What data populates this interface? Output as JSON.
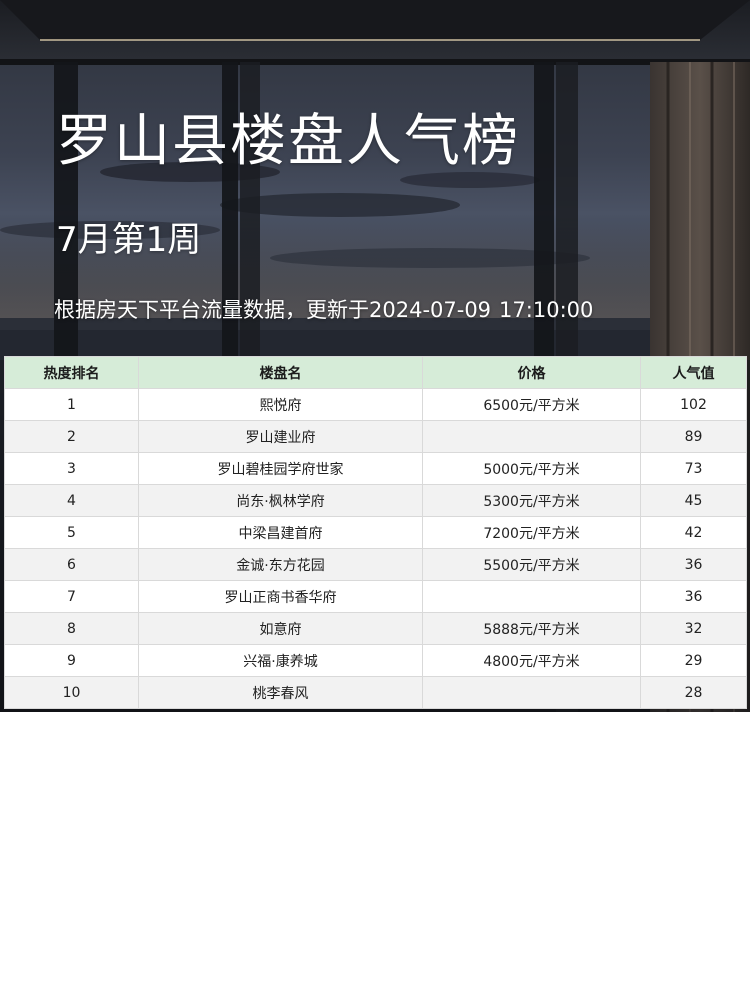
{
  "page": {
    "title": "罗山县楼盘人气榜",
    "subtitle": "7月第1周",
    "update_prefix": "根据房天下平台流量数据，更新于",
    "update_date": "2024-07-09",
    "update_time": "17:10:00"
  },
  "table": {
    "headers": [
      "热度排名",
      "楼盘名",
      "价格",
      "人气值"
    ],
    "rows": [
      {
        "rank": "1",
        "name": "熙悦府",
        "price": "6500元/平方米",
        "popularity": "102"
      },
      {
        "rank": "2",
        "name": "罗山建业府",
        "price": "",
        "popularity": "89"
      },
      {
        "rank": "3",
        "name": "罗山碧桂园学府世家",
        "price": "5000元/平方米",
        "popularity": "73"
      },
      {
        "rank": "4",
        "name": "尚东·枫林学府",
        "price": "5300元/平方米",
        "popularity": "45"
      },
      {
        "rank": "5",
        "name": "中梁昌建首府",
        "price": "7200元/平方米",
        "popularity": "42"
      },
      {
        "rank": "6",
        "name": "金诚·东方花园",
        "price": "5500元/平方米",
        "popularity": "36"
      },
      {
        "rank": "7",
        "name": "罗山正商书香华府",
        "price": "",
        "popularity": "36"
      },
      {
        "rank": "8",
        "name": "如意府",
        "price": "5888元/平方米",
        "popularity": "32"
      },
      {
        "rank": "9",
        "name": "兴福·康养城",
        "price": "4800元/平方米",
        "popularity": "29"
      },
      {
        "rank": "10",
        "name": "桃李春风",
        "price": "",
        "popularity": "28"
      }
    ]
  },
  "colors": {
    "header_bg": "#d6ecd8",
    "row_alt_bg": "#f2f2f2",
    "title_text": "#ffffff"
  }
}
